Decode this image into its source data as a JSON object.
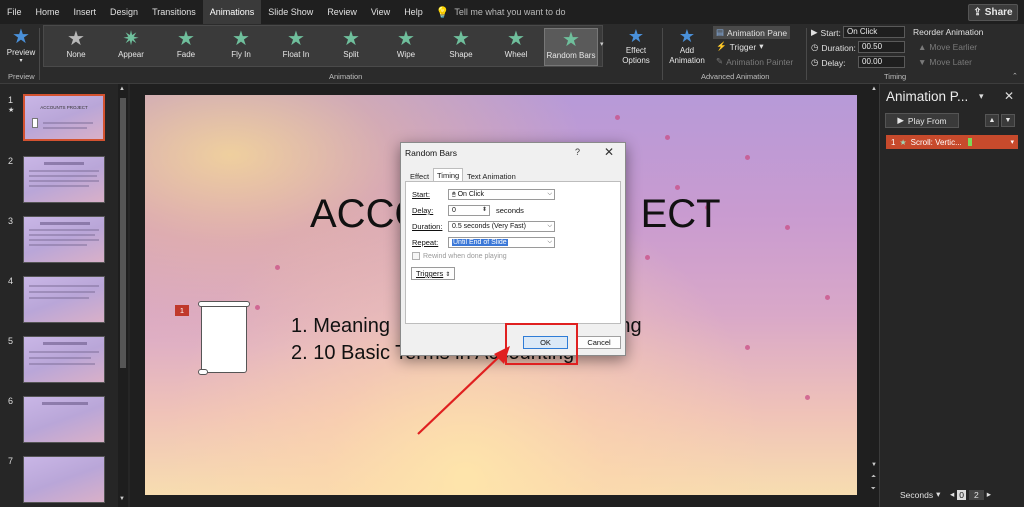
{
  "menu": {
    "items": [
      "File",
      "Home",
      "Insert",
      "Design",
      "Transitions",
      "Animations",
      "Slide Show",
      "Review",
      "View",
      "Help"
    ],
    "active": "Animations",
    "tell_me": "Tell me what you want to do",
    "share": "Share"
  },
  "ribbon": {
    "preview_label": "Preview",
    "preview_group": "Preview",
    "animations": [
      {
        "label": "None",
        "color": "#b8b8b8"
      },
      {
        "label": "Appear",
        "color": "#6fbf9c"
      },
      {
        "label": "Fade",
        "color": "#6fbf9c"
      },
      {
        "label": "Fly In",
        "color": "#6fbf9c"
      },
      {
        "label": "Float In",
        "color": "#6fbf9c"
      },
      {
        "label": "Split",
        "color": "#6fbf9c"
      },
      {
        "label": "Wipe",
        "color": "#6fbf9c"
      },
      {
        "label": "Shape",
        "color": "#6fbf9c"
      },
      {
        "label": "Wheel",
        "color": "#6fbf9c"
      },
      {
        "label": "Random Bars",
        "color": "#6fbf9c"
      }
    ],
    "selected_animation": "Random Bars",
    "animation_group": "Animation",
    "effect_options": "Effect Options",
    "add_animation": "Add Animation",
    "animation_pane": "Animation Pane",
    "trigger": "Trigger",
    "animation_painter": "Animation Painter",
    "advanced_group": "Advanced Animation",
    "start_label": "Start:",
    "start_value": "On Click",
    "duration_label": "Duration:",
    "duration_value": "00.50",
    "delay_label": "Delay:",
    "delay_value": "00.00",
    "reorder_title": "Reorder Animation",
    "move_earlier": "Move Earlier",
    "move_later": "Move Later",
    "timing_group": "Timing"
  },
  "slides": {
    "numbers": [
      "1",
      "2",
      "3",
      "4",
      "5",
      "6",
      "7"
    ],
    "star_mark": "★",
    "selected": 1,
    "thumb1_title": "ACCOUNTS PROJECT"
  },
  "slide": {
    "title": "ACCOUNTS PROJECT",
    "title_left": "ACCO",
    "title_right": "ECT",
    "bullet1_left": "1.  Meaning",
    "bullet1_right": "ounting",
    "bullet2_left": "2.  10 Basic",
    "bullet2_right": "Terms in Accounting",
    "anim_tag": "1"
  },
  "dialog": {
    "title": "Random Bars",
    "help": "?",
    "close": "✕",
    "tabs": [
      "Effect",
      "Timing",
      "Text Animation"
    ],
    "active_tab": "Timing",
    "start_label": "Start:",
    "start_value": "On Click",
    "delay_label": "Delay:",
    "delay_value": "0",
    "delay_unit": "seconds",
    "duration_label": "Duration:",
    "duration_value": "0.5 seconds (Very Fast)",
    "repeat_label": "Repeat:",
    "repeat_value": "Until End of Slide",
    "rewind_label": "Rewind when done playing",
    "triggers": "Triggers",
    "ok": "OK",
    "cancel": "Cancel"
  },
  "pane": {
    "title": "Animation P...",
    "play_from": "Play From",
    "item_num": "1",
    "item_label": "Scroll: Vertic..."
  },
  "status": {
    "seconds": "Seconds",
    "zoom_values": [
      "0",
      "2"
    ]
  },
  "colors": {
    "accent": "#d35230",
    "highlight": "#e02020",
    "ok_border": "#2f7cd6"
  }
}
